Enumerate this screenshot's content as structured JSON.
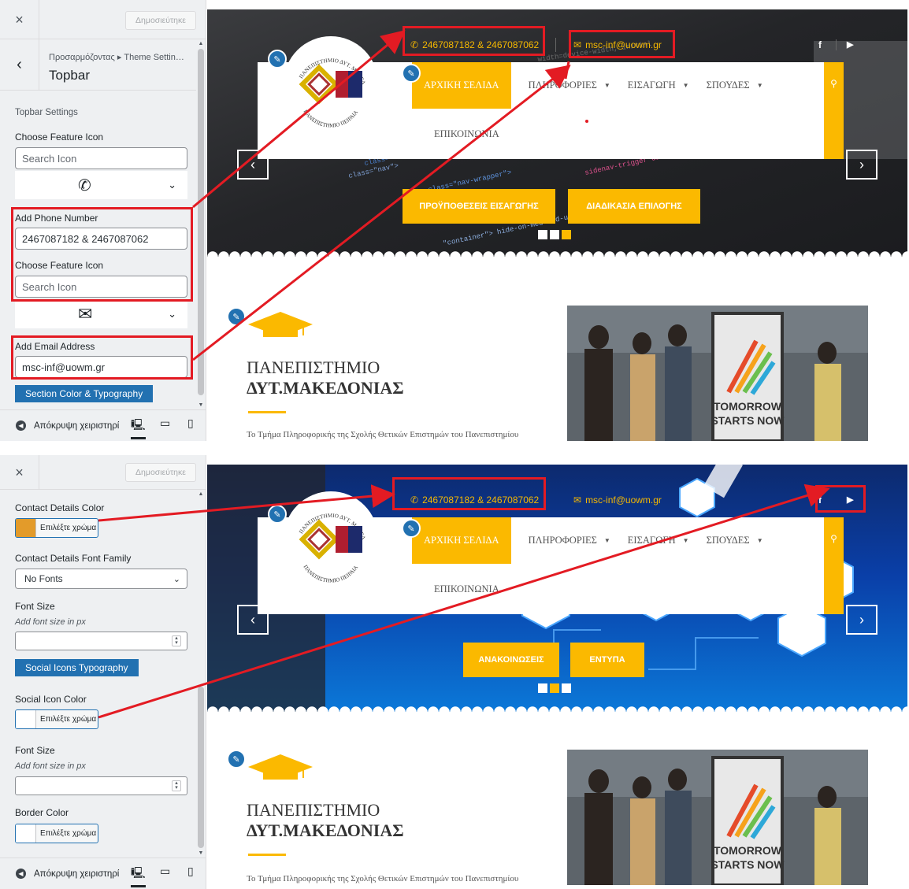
{
  "panel": {
    "close_label": "×",
    "publish_label": "Δημοσιεύτηκε",
    "breadcrumb": "Προσαρμόζοντας ▸ Theme Settin…",
    "title": "Topbar",
    "footer_hide_label": "Απόκρυψη χειριστηρί"
  },
  "panel1": {
    "section_title": "Topbar Settings",
    "choose_feature_icon_1": "Choose Feature Icon",
    "search_icon_placeholder_1": "Search Icon",
    "phone_label": "Add Phone Number",
    "phone_value": "2467087182 & 2467087062",
    "choose_feature_icon_2": "Choose Feature Icon",
    "search_icon_placeholder_2": "Search Icon",
    "email_label": "Add Email Address",
    "email_value": "msc-inf@uowm.gr",
    "section_color_button": "Section Color & Typography"
  },
  "panel2": {
    "contact_color_label": "Contact Details Color",
    "choose_color_1": "Επιλέξτε χρώμα",
    "contact_color_value": "#e39b2a",
    "font_family_label": "Contact Details Font Family",
    "font_family_value": "No Fonts",
    "font_size_label_1": "Font Size",
    "font_size_hint_1": "Add font size in px",
    "social_typography_button": "Social Icons Typography",
    "social_icon_color_label": "Social Icon Color",
    "choose_color_2": "Επιλέξτε χρώμα",
    "font_size_label_2": "Font Size",
    "font_size_hint_2": "Add font size in px",
    "border_color_label": "Border Color",
    "choose_color_3": "Επιλέξτε χρώμα"
  },
  "site": {
    "phone": "2467087182 & 2467087062",
    "email": "msc-inf@uowm.gr",
    "nav": [
      "ΑΡΧΙΚΗ ΣΕΛΙΔΑ",
      "ΠΛΗΡΟΦΟΡΙΕΣ",
      "ΕΙΣΑΓΩΓΗ",
      "ΣΠΟΥΔΕΣ"
    ],
    "nav_second_row": "ΕΠΙΚΟΙΝΩΝΙΑ",
    "uni_line1": "ΠΑΝΕΠΙΣΤΗΜΙΟ",
    "uni_line2": "ΔΥΤ.ΜΑΚΕΔΟΝΙΑΣ",
    "description": "Το Τμήμα Πληροφορικής της Σχολής Θετικών Επιστημών του Πανεπιστημίου",
    "photo_poster_line1": "TOMORROW",
    "photo_poster_line2": "STARTS NOW",
    "logo_text_top": "ΠΑΝΕΠΙΣΤΗΜΙΟ ΔΥΤ. ΜΑΚΕΔΟΝΙΑΣ",
    "logo_text_bottom": "ΠΑΝΕΠΙΣΤΗΜΙΟ ΠΕΙΡΑΙΑ"
  },
  "slide1": {
    "btn1": "ΠΡΟΫΠΟΘΕΣΕΙΣ ΕΙΣΑΓΩΓΗΣ",
    "btn2": "ΔΙΑΔΙΚΑΣΙΑ ΕΠΙΛΟΓΗΣ"
  },
  "slide2": {
    "btn1": "ΑΝΑΚΟΙΝΩΣΕΙΣ",
    "btn2": "ΕΝΤΥΠΑ"
  },
  "colors": {
    "accent": "#fbb900",
    "annotation": "#e31b23",
    "wp_blue": "#2271b1"
  }
}
